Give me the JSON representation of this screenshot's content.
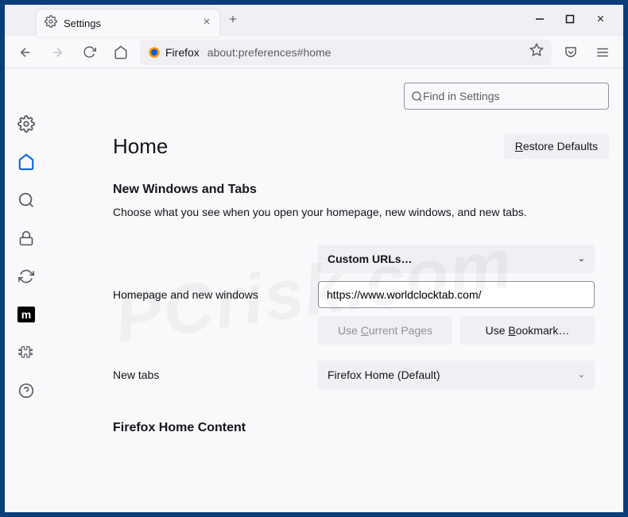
{
  "tab": {
    "title": "Settings"
  },
  "urlbar": {
    "label": "Firefox",
    "address": "about:preferences#home"
  },
  "search": {
    "placeholder": "Find in Settings"
  },
  "page": {
    "heading": "Home",
    "restore": "Restore Defaults",
    "section1_title": "New Windows and Tabs",
    "section1_desc": "Choose what you see when you open your homepage, new windows, and new tabs.",
    "homepage_label": "Homepage and new windows",
    "homepage_select": "Custom URLs…",
    "homepage_url": "https://www.worldclocktab.com/",
    "use_current": "Use Current Pages",
    "use_bookmark": "Use Bookmark…",
    "newtabs_label": "New tabs",
    "newtabs_select": "Firefox Home (Default)",
    "section2_title": "Firefox Home Content"
  },
  "watermark": "PCrisk.com"
}
